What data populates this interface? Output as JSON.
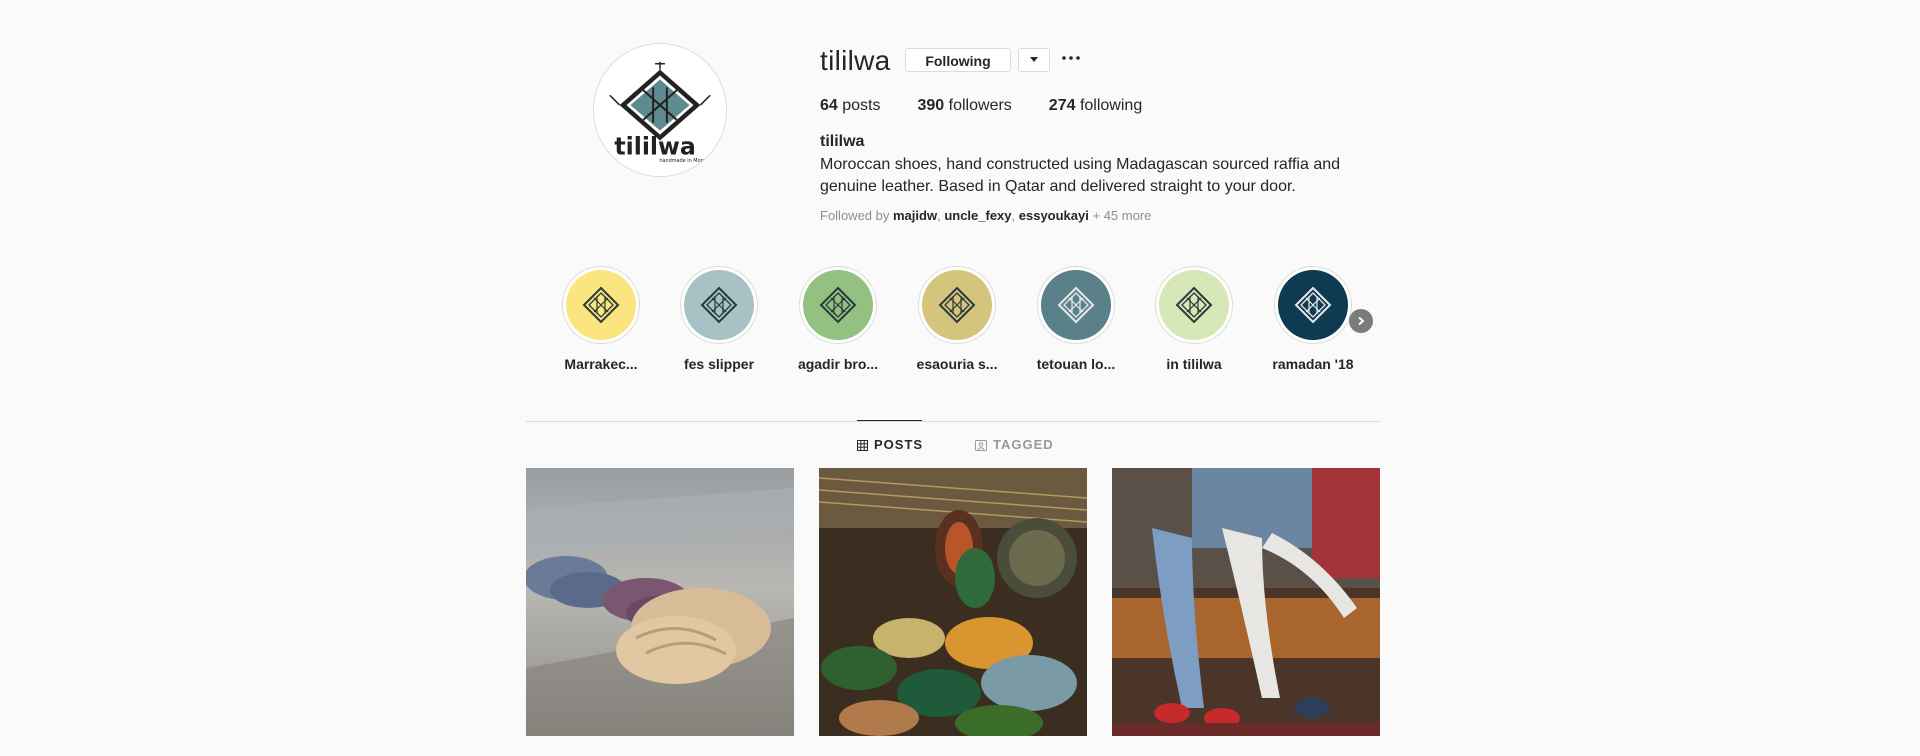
{
  "profile": {
    "username": "tililwa",
    "following_button": "Following",
    "more_label": "···",
    "stats": {
      "posts_count": "64",
      "posts_label": "posts",
      "followers_count": "390",
      "followers_label": "followers",
      "following_count": "274",
      "following_label": "following"
    },
    "full_name": "tililwa",
    "bio_line1": "Moroccan shoes, hand constructed using Madagascan sourced raffia and",
    "bio_line2": "genuine leather. Based in Qatar and delivered straight to your door.",
    "followed_by": {
      "prefix": "Followed by",
      "users": [
        "majidw",
        "uncle_fexy",
        "essyoukayi"
      ],
      "more": "+ 45 more"
    },
    "logo_text": "tililwa",
    "logo_subtext": "handmade in Morocco"
  },
  "highlights": [
    {
      "label": "Marrakec...",
      "color": "#fbe57e"
    },
    {
      "label": "fes slipper",
      "color": "#a6c2c5"
    },
    {
      "label": "agadir bro...",
      "color": "#93c182"
    },
    {
      "label": "esaouria s...",
      "color": "#d5c47c"
    },
    {
      "label": "tetouan lo...",
      "color": "#5a8089"
    },
    {
      "label": "in tililwa",
      "color": "#d6e8b7"
    },
    {
      "label": "ramadan '18",
      "color": "#0e3a52"
    }
  ],
  "tabs": {
    "posts": "POSTS",
    "tagged": "TAGGED"
  },
  "posts": [
    {
      "subject": "raffia shoes on stone"
    },
    {
      "subject": "moroccan ceramic plates and lanterns"
    },
    {
      "subject": "people on sofa wearing shoes"
    }
  ],
  "colors": {
    "background": "#fafafa",
    "border": "#dbdbdb",
    "text": "#262626",
    "muted": "#8e8e8e"
  }
}
